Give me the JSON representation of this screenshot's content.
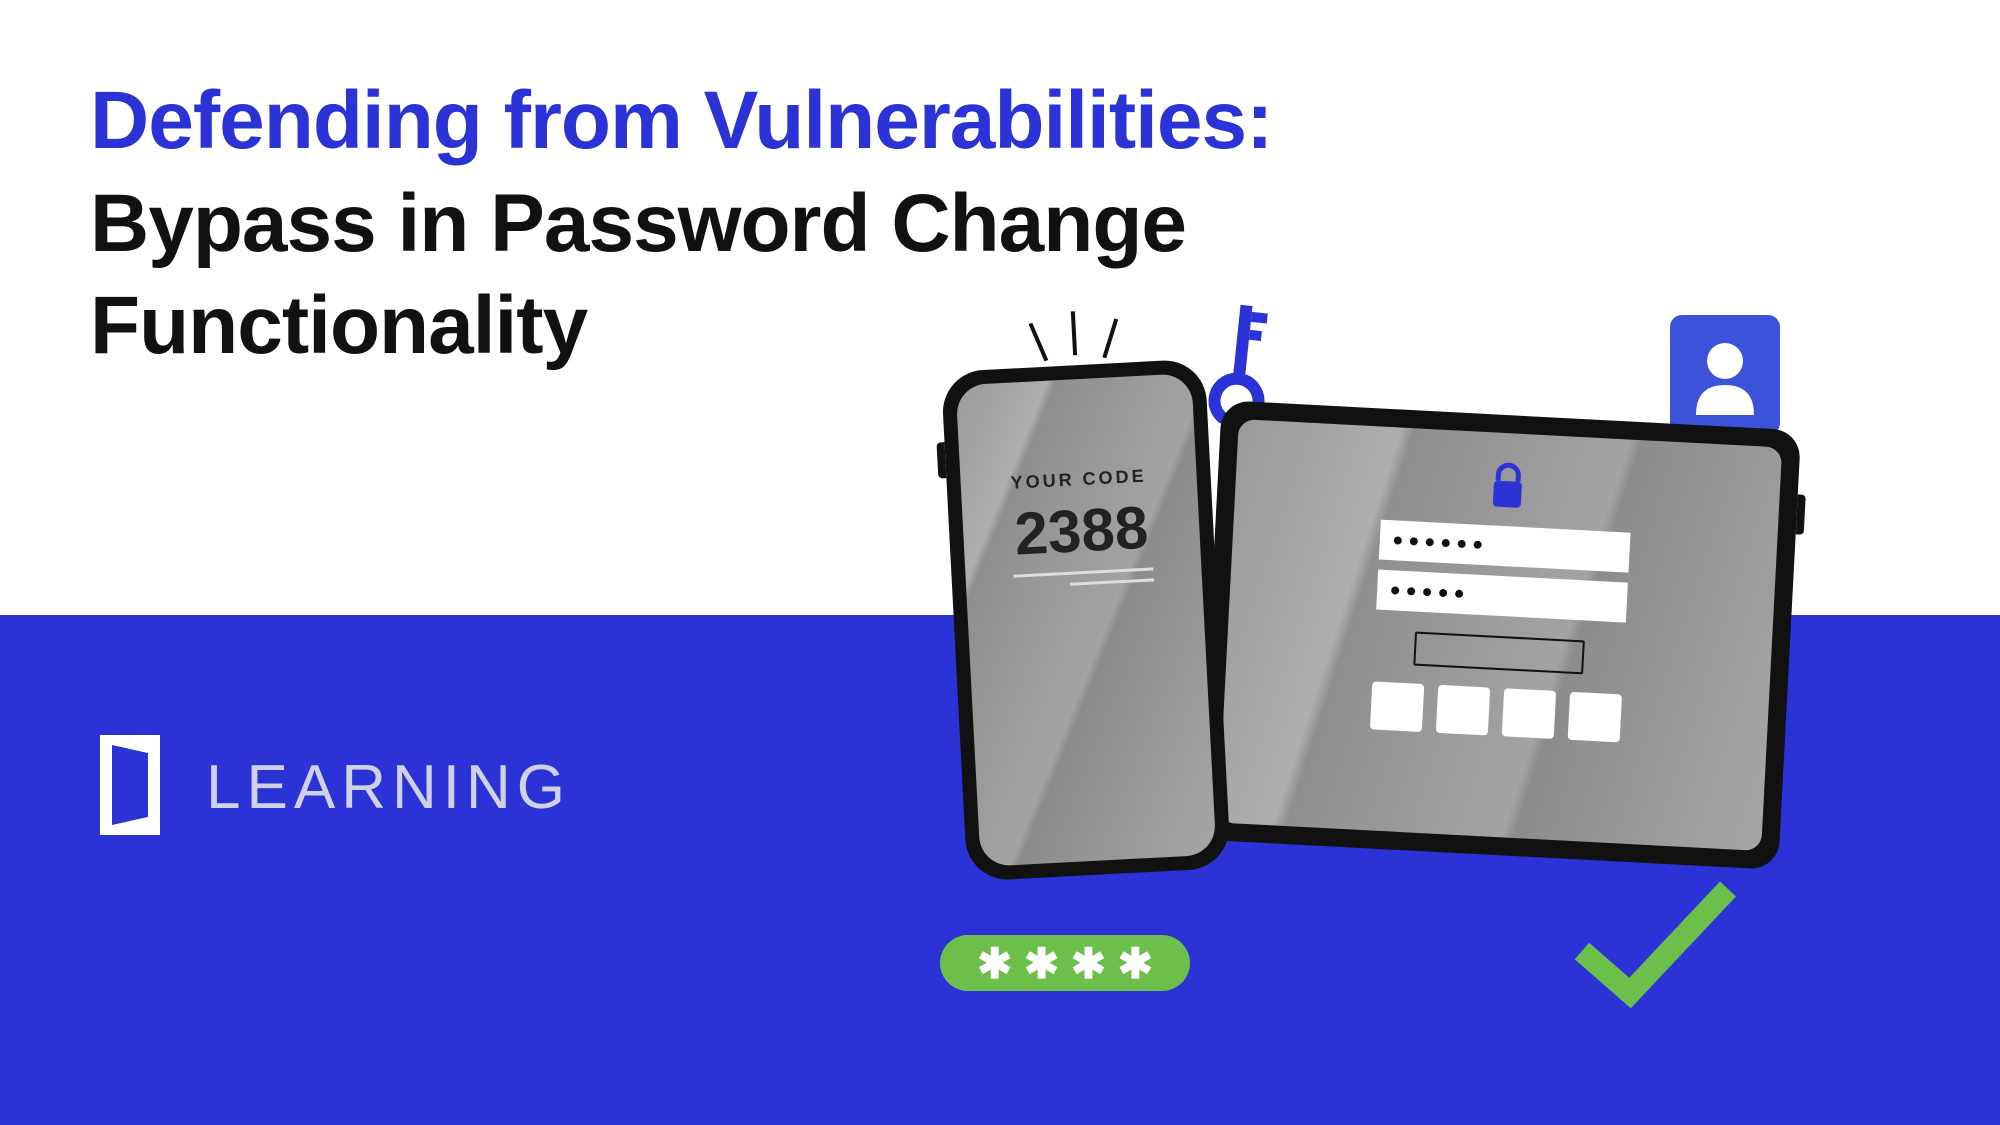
{
  "title_line1": "Defending from Vulnerabilities:",
  "title_line2": "Bypass in Password Change",
  "title_line3": "Functionality",
  "brand": "LEARNING",
  "phone": {
    "label": "YOUR CODE",
    "code": "2388"
  },
  "pill": {
    "stars": "✱ ✱ ✱ ✱"
  }
}
